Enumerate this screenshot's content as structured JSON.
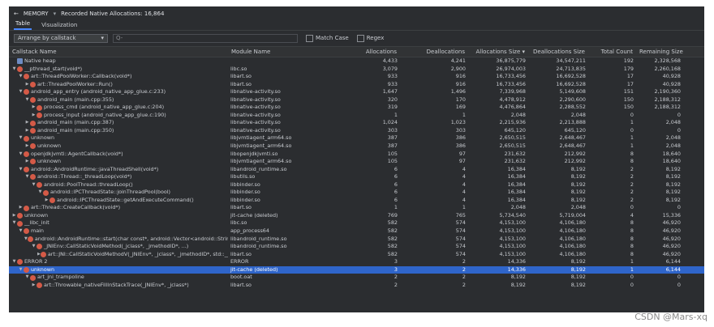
{
  "header": {
    "back_glyph": "←",
    "profile_label": "MEMORY",
    "dropdown_glyph": "▾",
    "recorded_text": "Recorded Native Allocations: 16,864"
  },
  "tabs": [
    "Table",
    "Visualization"
  ],
  "toolbar": {
    "arrange_value": "Arrange by callstack",
    "filter_placeholder": "Q-",
    "match_case": "Match Case",
    "regex": "Regex"
  },
  "columns": [
    "Callstack Name",
    "Module Name",
    "Allocations",
    "Deallocations",
    "Allocations Size ▾",
    "Deallocations Size",
    "Total Count",
    "Remaining Size"
  ],
  "rows": [
    {
      "depth": 0,
      "tri": "",
      "icon": "heap",
      "name": "Native heap",
      "module": "",
      "alloc": "4,433",
      "dealloc": "4,241",
      "asize": "36,875,779",
      "dsize": "34,547,211",
      "total": "192",
      "remaining": "2,328,568",
      "bars": [
        0,
        0,
        0,
        0,
        0,
        0
      ]
    },
    {
      "depth": 0,
      "tri": "▼",
      "icon": "func",
      "name": "__pthread_start(void*)",
      "module": "libc.so",
      "alloc": "3,079",
      "dealloc": "2,900",
      "asize": "26,974,003",
      "dsize": "24,713,835",
      "total": "179",
      "remaining": "2,260,168",
      "bars": [
        0.69,
        0.68,
        0.73,
        0.72,
        0.93,
        0.97
      ]
    },
    {
      "depth": 1,
      "tri": "▼",
      "icon": "func",
      "name": "art::ThreadPoolWorker::Callback(void*)",
      "module": "libart.so",
      "alloc": "933",
      "dealloc": "916",
      "asize": "16,733,456",
      "dsize": "16,692,528",
      "total": "17",
      "remaining": "40,928",
      "bars": [
        0.21,
        0.22,
        0.45,
        0.48,
        0.09,
        0
      ]
    },
    {
      "depth": 2,
      "tri": "▶",
      "icon": "func",
      "name": "art::ThreadPoolWorker::Run()",
      "module": "libart.so",
      "alloc": "933",
      "dealloc": "916",
      "asize": "16,733,456",
      "dsize": "16,692,528",
      "total": "17",
      "remaining": "40,928",
      "bars": [
        0.21,
        0.22,
        0.45,
        0.48,
        0.09,
        0
      ]
    },
    {
      "depth": 1,
      "tri": "▼",
      "icon": "func",
      "name": "android_app_entry (android_native_app_glue.c:233)",
      "module": "libnative-activity.so",
      "alloc": "1,647",
      "dealloc": "1,496",
      "asize": "7,339,968",
      "dsize": "5,149,608",
      "total": "151",
      "remaining": "2,190,360",
      "bars": [
        0.37,
        0.35,
        0,
        0,
        0.79,
        0.94
      ]
    },
    {
      "depth": 2,
      "tri": "▼",
      "icon": "func",
      "name": "android_main (main.cpp:355)",
      "module": "libnative-activity.so",
      "alloc": "320",
      "dealloc": "170",
      "asize": "4,478,912",
      "dsize": "2,290,600",
      "total": "150",
      "remaining": "2,188,312",
      "bars": [
        0,
        0,
        0,
        0,
        0.78,
        0.94
      ]
    },
    {
      "depth": 3,
      "tri": "▶",
      "icon": "func",
      "name": "process_cmd (android_native_app_glue.c:204)",
      "module": "libnative-activity.so",
      "alloc": "319",
      "dealloc": "169",
      "asize": "4,476,864",
      "dsize": "2,288,552",
      "total": "150",
      "remaining": "2,188,312",
      "bars": [
        0,
        0,
        0,
        0,
        0.78,
        0.94
      ]
    },
    {
      "depth": 3,
      "tri": "▶",
      "icon": "func",
      "name": "process_input (android_native_app_glue.c:190)",
      "module": "libnative-activity.so",
      "alloc": "1",
      "dealloc": "1",
      "asize": "2,048",
      "dsize": "2,048",
      "total": "0",
      "remaining": "0",
      "bars": [
        0,
        0,
        0,
        0,
        0,
        0
      ]
    },
    {
      "depth": 2,
      "tri": "▶",
      "icon": "func",
      "name": "android_main (main.cpp:387)",
      "module": "libnative-activity.so",
      "alloc": "1,024",
      "dealloc": "1,023",
      "asize": "2,215,936",
      "dsize": "2,213,888",
      "total": "1",
      "remaining": "2,048",
      "bars": [
        0.23,
        0.24,
        0,
        0,
        0,
        0
      ]
    },
    {
      "depth": 2,
      "tri": "▶",
      "icon": "func",
      "name": "android_main (main.cpp:350)",
      "module": "libnative-activity.so",
      "alloc": "303",
      "dealloc": "303",
      "asize": "645,120",
      "dsize": "645,120",
      "total": "0",
      "remaining": "0",
      "bars": [
        0,
        0,
        0,
        0,
        0,
        0
      ]
    },
    {
      "depth": 1,
      "tri": "▼",
      "icon": "func",
      "name": "unknown",
      "module": "libjvmtiagent_arm64.so",
      "alloc": "387",
      "dealloc": "386",
      "asize": "2,650,515",
      "dsize": "2,648,467",
      "total": "1",
      "remaining": "2,048",
      "bars": [
        0,
        0,
        0,
        0,
        0,
        0
      ]
    },
    {
      "depth": 2,
      "tri": "▶",
      "icon": "func",
      "name": "unknown",
      "module": "libjvmtiagent_arm64.so",
      "alloc": "387",
      "dealloc": "386",
      "asize": "2,650,515",
      "dsize": "2,648,467",
      "total": "1",
      "remaining": "2,048",
      "bars": [
        0,
        0,
        0,
        0,
        0,
        0
      ]
    },
    {
      "depth": 1,
      "tri": "▼",
      "icon": "func",
      "name": "openjdkjvmti::AgentCallback(void*)",
      "module": "libopenjdkjvmti.so",
      "alloc": "105",
      "dealloc": "97",
      "asize": "231,632",
      "dsize": "212,992",
      "total": "8",
      "remaining": "18,640",
      "bars": [
        0,
        0,
        0,
        0,
        0,
        0
      ]
    },
    {
      "depth": 2,
      "tri": "▶",
      "icon": "func",
      "name": "unknown",
      "module": "libjvmtiagent_arm64.so",
      "alloc": "105",
      "dealloc": "97",
      "asize": "231,632",
      "dsize": "212,992",
      "total": "8",
      "remaining": "18,640",
      "bars": [
        0,
        0,
        0,
        0,
        0,
        0
      ]
    },
    {
      "depth": 1,
      "tri": "▼",
      "icon": "func",
      "name": "android::AndroidRuntime::javaThreadShell(void*)",
      "module": "libandroid_runtime.so",
      "alloc": "6",
      "dealloc": "4",
      "asize": "16,384",
      "dsize": "8,192",
      "total": "2",
      "remaining": "8,192",
      "bars": [
        0,
        0,
        0,
        0,
        0,
        0
      ]
    },
    {
      "depth": 2,
      "tri": "▼",
      "icon": "func",
      "name": "android::Thread::_threadLoop(void*)",
      "module": "libutils.so",
      "alloc": "6",
      "dealloc": "4",
      "asize": "16,384",
      "dsize": "8,192",
      "total": "2",
      "remaining": "8,192",
      "bars": [
        0,
        0,
        0,
        0,
        0,
        0
      ]
    },
    {
      "depth": 3,
      "tri": "▼",
      "icon": "func",
      "name": "android::PoolThread::threadLoop()",
      "module": "libbinder.so",
      "alloc": "6",
      "dealloc": "4",
      "asize": "16,384",
      "dsize": "8,192",
      "total": "2",
      "remaining": "8,192",
      "bars": [
        0,
        0,
        0,
        0,
        0,
        0
      ]
    },
    {
      "depth": 4,
      "tri": "▼",
      "icon": "func",
      "name": "android::IPCThreadState::joinThreadPool(bool)",
      "module": "libbinder.so",
      "alloc": "6",
      "dealloc": "4",
      "asize": "16,384",
      "dsize": "8,192",
      "total": "2",
      "remaining": "8,192",
      "bars": [
        0,
        0,
        0,
        0,
        0,
        0
      ]
    },
    {
      "depth": 5,
      "tri": "▶",
      "icon": "func",
      "name": "android::IPCThreadState::getAndExecuteCommand()",
      "module": "libbinder.so",
      "alloc": "6",
      "dealloc": "4",
      "asize": "16,384",
      "dsize": "8,192",
      "total": "2",
      "remaining": "8,192",
      "bars": [
        0,
        0,
        0,
        0,
        0,
        0
      ]
    },
    {
      "depth": 1,
      "tri": "▶",
      "icon": "func",
      "name": "art::Thread::CreateCallback(void*)",
      "module": "libart.so",
      "alloc": "1",
      "dealloc": "1",
      "asize": "2,048",
      "dsize": "2,048",
      "total": "0",
      "remaining": "0",
      "bars": [
        0,
        0,
        0,
        0,
        0,
        0
      ]
    },
    {
      "depth": 0,
      "tri": "▶",
      "icon": "func",
      "name": "unknown",
      "module": "jit-cache (deleted)",
      "alloc": "769",
      "dealloc": "765",
      "asize": "5,734,540",
      "dsize": "5,719,004",
      "total": "4",
      "remaining": "15,336",
      "bars": [
        0.17,
        0.18,
        0,
        0,
        0,
        0
      ]
    },
    {
      "depth": 0,
      "tri": "▼",
      "icon": "func",
      "name": "__libc_init",
      "module": "libc.so",
      "alloc": "582",
      "dealloc": "574",
      "asize": "4,153,100",
      "dsize": "4,106,180",
      "total": "8",
      "remaining": "46,920",
      "bars": [
        0.13,
        0.13,
        0,
        0,
        0,
        0
      ]
    },
    {
      "depth": 1,
      "tri": "▼",
      "icon": "func",
      "name": "main",
      "module": "app_process64",
      "alloc": "582",
      "dealloc": "574",
      "asize": "4,153,100",
      "dsize": "4,106,180",
      "total": "8",
      "remaining": "46,920",
      "bars": [
        0.13,
        0.13,
        0,
        0,
        0,
        0
      ]
    },
    {
      "depth": 2,
      "tri": "▼",
      "icon": "func",
      "name": "android::AndroidRuntime::start(char const*, android::Vector<android::String8> const&, bool)",
      "module": "libandroid_runtime.so",
      "alloc": "582",
      "dealloc": "574",
      "asize": "4,153,100",
      "dsize": "4,106,180",
      "total": "8",
      "remaining": "46,920",
      "bars": [
        0.13,
        0.13,
        0,
        0,
        0,
        0
      ]
    },
    {
      "depth": 3,
      "tri": "▼",
      "icon": "func",
      "name": "_JNIEnv::CallStaticVoidMethod(_jclass*, _jmethodID*, ...)",
      "module": "libandroid_runtime.so",
      "alloc": "582",
      "dealloc": "574",
      "asize": "4,153,100",
      "dsize": "4,106,180",
      "total": "8",
      "remaining": "46,920",
      "bars": [
        0.13,
        0.13,
        0,
        0,
        0,
        0
      ]
    },
    {
      "depth": 4,
      "tri": "▶",
      "icon": "func",
      "name": "art::JNI::CallStaticVoidMethodV(_JNIEnv*, _jclass*, _jmethodID*, std::__va_list)",
      "module": "libart.so",
      "alloc": "582",
      "dealloc": "574",
      "asize": "4,153,100",
      "dsize": "4,106,180",
      "total": "8",
      "remaining": "46,920",
      "bars": [
        0.13,
        0.13,
        0,
        0,
        0,
        0
      ]
    },
    {
      "depth": 0,
      "tri": "▼",
      "icon": "func",
      "name": "ERROR 2",
      "module": "ERROR",
      "alloc": "3",
      "dealloc": "2",
      "asize": "14,336",
      "dsize": "8,192",
      "total": "1",
      "remaining": "6,144",
      "bars": [
        0,
        0,
        0,
        0,
        0,
        0
      ]
    },
    {
      "depth": 1,
      "tri": "▼",
      "icon": "func",
      "name": "unknown",
      "module": "jit-cache (deleted)",
      "alloc": "3",
      "dealloc": "2",
      "asize": "14,336",
      "dsize": "8,192",
      "total": "1",
      "remaining": "6,144",
      "bars": [
        0,
        0,
        0,
        0,
        0,
        0
      ],
      "selected": true
    },
    {
      "depth": 2,
      "tri": "▼",
      "icon": "func",
      "name": "art_jni_trampoline",
      "module": "boot.oat",
      "alloc": "2",
      "dealloc": "2",
      "asize": "8,192",
      "dsize": "8,192",
      "total": "0",
      "remaining": "0",
      "bars": [
        0,
        0,
        0,
        0,
        0,
        0
      ]
    },
    {
      "depth": 3,
      "tri": "▶",
      "icon": "func",
      "name": "art::Throwable_nativeFillInStackTrace(_JNIEnv*, _jclass*)",
      "module": "libart.so",
      "alloc": "2",
      "dealloc": "2",
      "asize": "8,192",
      "dsize": "8,192",
      "total": "0",
      "remaining": "0",
      "bars": [
        0,
        0,
        0,
        0,
        0,
        0
      ]
    }
  ],
  "watermark": "CSDN @Mars-xq"
}
